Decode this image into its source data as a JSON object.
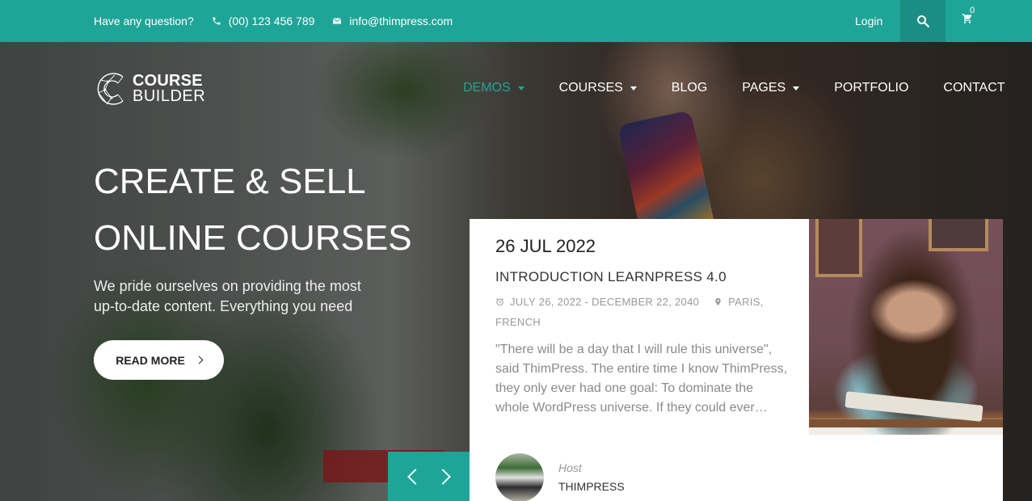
{
  "topbar": {
    "question": "Have any question?",
    "phone": "(00) 123 456 789",
    "email": "info@thimpress.com",
    "login": "Login",
    "cart_count": "0",
    "color": "#1fa597"
  },
  "logo": {
    "line1": "COURSE",
    "line2": "BUILDER"
  },
  "nav": {
    "items": [
      {
        "label": "DEMOS",
        "has_dropdown": true,
        "active": true
      },
      {
        "label": "COURSES",
        "has_dropdown": true,
        "active": false
      },
      {
        "label": "BLOG",
        "has_dropdown": false,
        "active": false
      },
      {
        "label": "PAGES",
        "has_dropdown": true,
        "active": false
      },
      {
        "label": "PORTFOLIO",
        "has_dropdown": false,
        "active": false
      },
      {
        "label": "CONTACT",
        "has_dropdown": false,
        "active": false
      }
    ]
  },
  "hero": {
    "headline_line1": "CREATE & SELL",
    "headline_line2": "ONLINE COURSES",
    "subtext": "We pride ourselves on providing the most up-to-date content. Everything you need",
    "read_more": "READ MORE"
  },
  "event": {
    "date": "26 JUL 2022",
    "title": "INTRODUCTION LEARNPRESS 4.0",
    "time_range": "JULY 26, 2022 - DECEMBER 22, 2040",
    "location": "PARIS, FRENCH",
    "excerpt": "\"There will be a day that I will rule this universe\", said ThimPress. The entire time I know ThimPress, they only ever had one goal: To dominate the whole WordPress universe. If they could ever…",
    "host_role": "Host",
    "host_name": "THIMPRESS"
  }
}
